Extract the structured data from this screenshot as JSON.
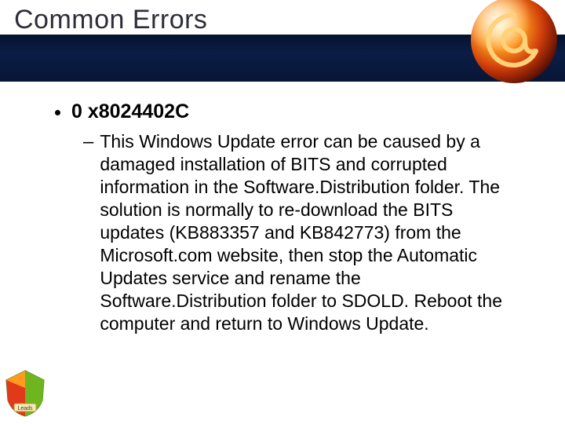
{
  "title": "Common Errors",
  "bullets": [
    {
      "code": "0 x8024402C",
      "sub": "This Windows Update error can be caused by a damaged installation of BITS and corrupted information in the Software.Distribution folder. The solution is normally to re-download the BITS updates (KB883357 and KB842773) from the Microsoft.com website, then stop the Automatic Updates service and rename the Software.Distribution folder to SDOLD. Reboot the computer and return to Windows Update."
    }
  ],
  "badge_label": "Leads"
}
